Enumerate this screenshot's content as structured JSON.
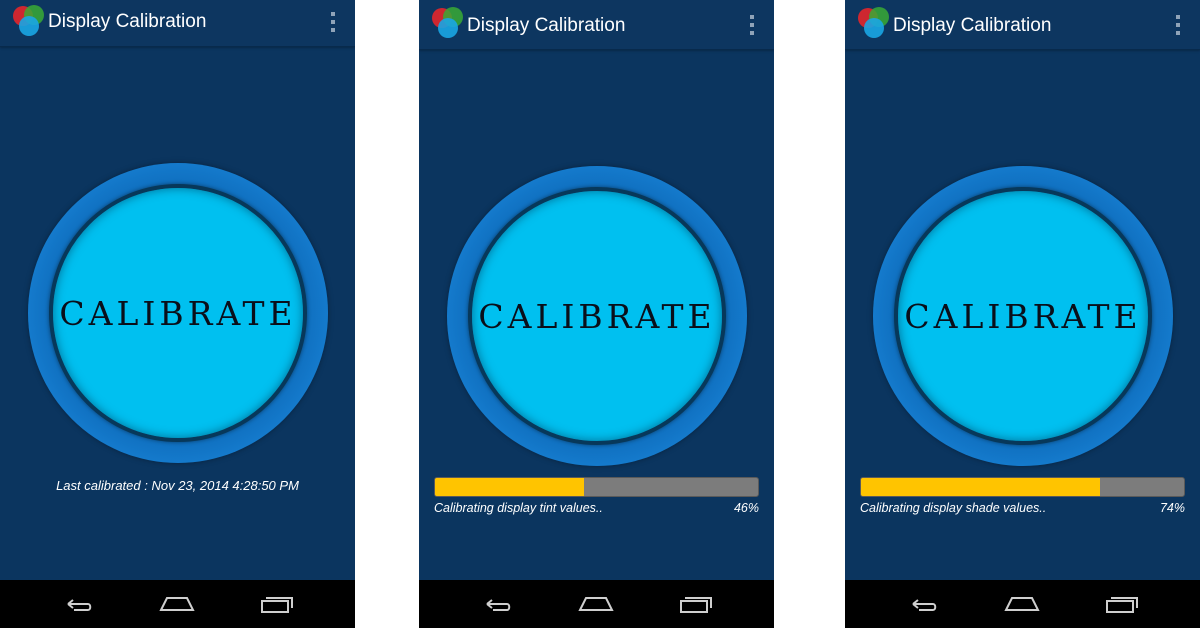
{
  "screens": [
    {
      "app_title": "Display Calibration",
      "calibrate_label": "CALIBRATE",
      "last_calibrated": "Last calibrated : Nov 23, 2014 4:28:50 PM"
    },
    {
      "app_title": "Display Calibration",
      "calibrate_label": "CALIBRATE",
      "progress": {
        "status": "Calibrating display tint values..",
        "percent_label": "46%",
        "value": 0.46
      }
    },
    {
      "app_title": "Display Calibration",
      "calibrate_label": "CALIBRATE",
      "progress": {
        "status": "Calibrating display shade values..",
        "percent_label": "74%",
        "value": 0.74
      }
    }
  ],
  "icons": {
    "app_logo": "rgb-circles-logo",
    "overflow": "overflow-menu-icon",
    "back": "back-icon",
    "home": "home-icon",
    "recents": "recent-apps-icon"
  },
  "colors": {
    "background": "#0b355f",
    "button_face": "#00c0f0",
    "button_ring": "#1a86da",
    "progress_fill": "#ffc400",
    "progress_track": "#7c7c7c",
    "nav_bar": "#000000"
  }
}
